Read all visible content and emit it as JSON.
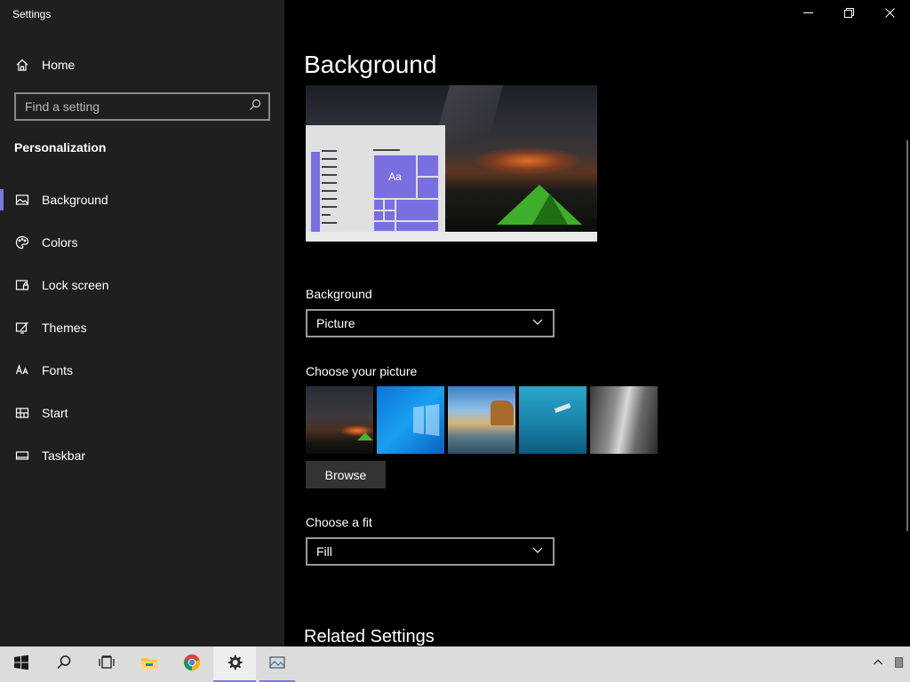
{
  "window": {
    "title": "Settings"
  },
  "sidebar": {
    "home_label": "Home",
    "search_placeholder": "Find a setting",
    "section_title": "Personalization",
    "items": [
      {
        "label": "Background",
        "icon": "image-icon",
        "active": true
      },
      {
        "label": "Colors",
        "icon": "palette-icon",
        "active": false
      },
      {
        "label": "Lock screen",
        "icon": "lock-screen-icon",
        "active": false
      },
      {
        "label": "Themes",
        "icon": "themes-brush-icon",
        "active": false
      },
      {
        "label": "Fonts",
        "icon": "fonts-icon",
        "active": false
      },
      {
        "label": "Start",
        "icon": "start-grid-icon",
        "active": false
      },
      {
        "label": "Taskbar",
        "icon": "taskbar-icon",
        "active": false
      }
    ]
  },
  "main": {
    "page_title": "Background",
    "preview": {
      "tile_label": "Aa"
    },
    "background_label": "Background",
    "background_value": "Picture",
    "choose_picture_label": "Choose your picture",
    "pictures": [
      {
        "name": "night-sky-tent-thumbnail"
      },
      {
        "name": "windows-blue-logo-thumbnail"
      },
      {
        "name": "beach-rock-arch-thumbnail"
      },
      {
        "name": "underwater-diver-thumbnail"
      },
      {
        "name": "rock-cliff-thumbnail"
      }
    ],
    "browse_label": "Browse",
    "choose_fit_label": "Choose a fit",
    "fit_value": "Fill",
    "related_settings": "Related Settings"
  },
  "taskbar": {
    "items": [
      "windows-start-icon",
      "search-icon",
      "task-view-icon",
      "file-explorer-icon",
      "chrome-icon",
      "settings-gear-icon",
      "photos-app-icon"
    ]
  },
  "colors": {
    "accent": "#7777e0",
    "sidebar_bg": "#1f1f1f",
    "main_bg": "#000000",
    "taskbar_bg": "#dcdcdc"
  }
}
